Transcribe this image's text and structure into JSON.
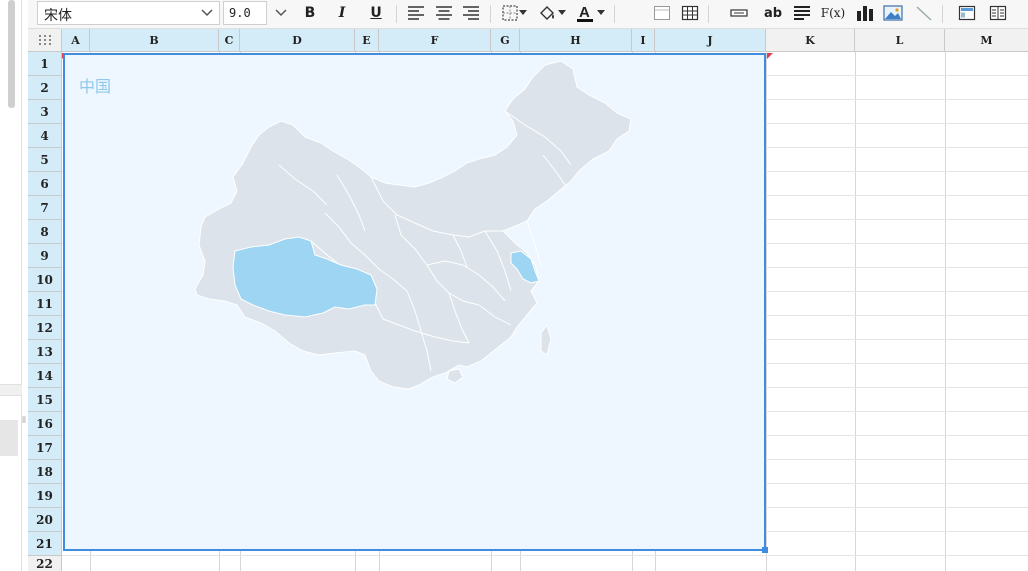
{
  "toolbar": {
    "font_name": "宋体",
    "font_size": "9.0",
    "bold_label": "B",
    "italic_label": "I",
    "underline_label": "U",
    "text_tool_label": "ab",
    "formula_label": "F(x)"
  },
  "sheet": {
    "columns": [
      "A",
      "B",
      "C",
      "D",
      "E",
      "F",
      "G",
      "H",
      "I",
      "J",
      "K",
      "L",
      "M"
    ],
    "rows": [
      "1",
      "2",
      "3",
      "4",
      "5",
      "6",
      "7",
      "8",
      "9",
      "10",
      "11",
      "12",
      "13",
      "14",
      "15",
      "16",
      "17",
      "18",
      "19",
      "20",
      "21",
      "22"
    ]
  },
  "chart": {
    "title": "中国",
    "base_color": "#dde3ea",
    "highlight_color": "#9dd5f2",
    "background_color": "#eef6ff",
    "border_color": "#3f8ce0",
    "highlighted_regions": [
      "西藏",
      "江苏"
    ]
  }
}
